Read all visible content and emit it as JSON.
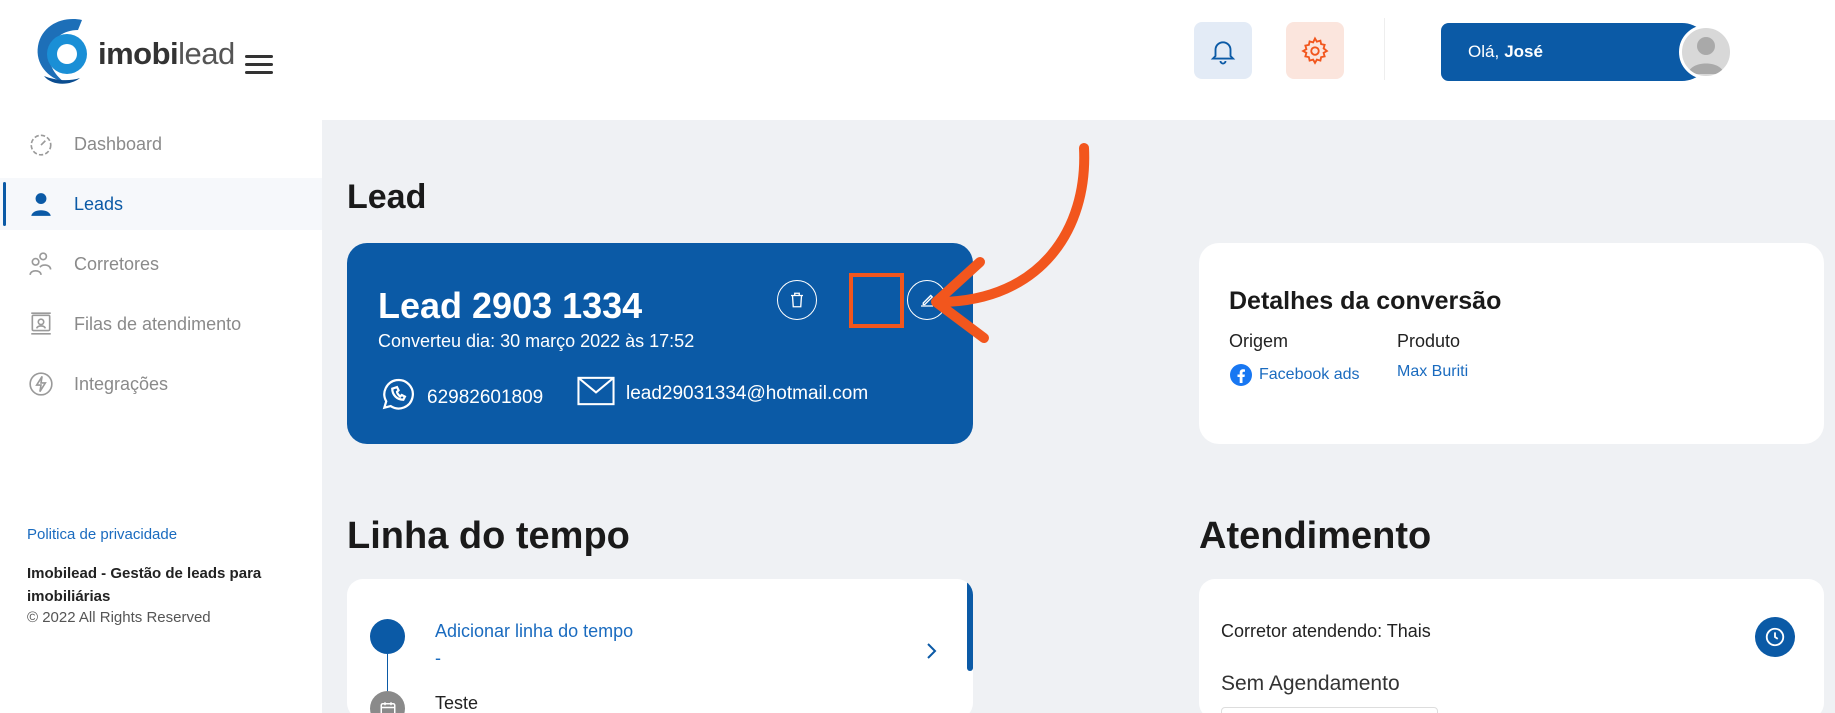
{
  "brand": {
    "name_bold": "imobi",
    "name_light": "lead"
  },
  "header": {
    "greeting": "Olá,",
    "user_name": "José"
  },
  "sidebar": {
    "items": [
      {
        "label": "Dashboard",
        "icon": "dashboard-icon",
        "active": false
      },
      {
        "label": "Leads",
        "icon": "user-icon",
        "active": true
      },
      {
        "label": "Corretores",
        "icon": "users-icon",
        "active": false
      },
      {
        "label": "Filas de atendimento",
        "icon": "queue-icon",
        "active": false
      },
      {
        "label": "Integrações",
        "icon": "bolt-icon",
        "active": false
      }
    ],
    "privacy": "Politica de privacidade",
    "company": "Imobilead - Gestão de leads para imobiliárias",
    "copyright": "© 2022 All Rights Reserved"
  },
  "lead_section": {
    "heading": "Lead",
    "title": "Lead 2903 1334",
    "converted": "Converteu dia: 30 março 2022 às 17:52",
    "phone": "62982601809",
    "email": "lead29031334@hotmail.com"
  },
  "conversion": {
    "title": "Detalhes da conversão",
    "origin_label": "Origem",
    "origin_value": "Facebook ads",
    "product_label": "Produto",
    "product_value": "Max Buriti"
  },
  "timeline": {
    "heading": "Linha do tempo",
    "add_label": "Adicionar linha do tempo",
    "add_sub": "-",
    "item": "Teste"
  },
  "attendance": {
    "heading": "Atendimento",
    "broker": "Corretor atendendo: Thais",
    "schedule": "Sem Agendamento"
  },
  "colors": {
    "primary": "#0b5aa6",
    "accent_orange": "#f2561d",
    "background": "#eff1f4"
  }
}
